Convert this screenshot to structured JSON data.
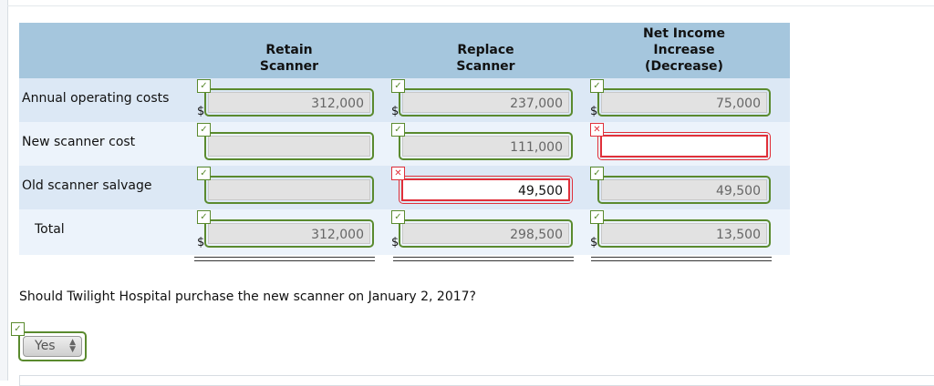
{
  "headers": {
    "retain": [
      "Retain",
      "Scanner"
    ],
    "replace": [
      "Replace",
      "Scanner"
    ],
    "net": [
      "Net Income",
      "Increase",
      "(Decrease)"
    ]
  },
  "rows": [
    {
      "label": "Annual operating costs",
      "dollar": "$",
      "retain": "312,000",
      "replace": "237,000",
      "net": "75,000"
    },
    {
      "label": "New scanner cost",
      "retain": "",
      "replace": "111,000",
      "net": ""
    },
    {
      "label": "Old scanner salvage",
      "retain": "",
      "replace": "49,500",
      "net": "49,500"
    },
    {
      "label": "Total",
      "dollar": "$",
      "retain": "312,000",
      "replace": "298,500",
      "net": "13,500"
    }
  ],
  "marks": {
    "correct": "✓",
    "incorrect": "✕"
  },
  "question": "Should Twilight Hospital purchase the new scanner on January 2, 2017?",
  "answer_select": {
    "value": "Yes",
    "arrows": "▲▼"
  },
  "colors": {
    "correct": "#5a8a2e",
    "incorrect": "#e0303a",
    "header": "#a5c6dd"
  }
}
